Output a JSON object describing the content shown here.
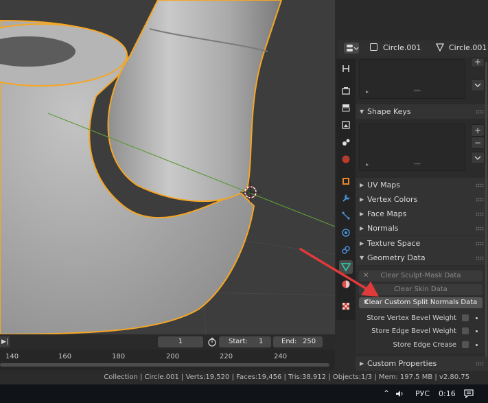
{
  "properties_header": {
    "object_name": "Circle.001",
    "mesh_name": "Circle.001"
  },
  "panels": {
    "shape_keys": "Shape Keys",
    "uv_maps": "UV Maps",
    "vertex_colors": "Vertex Colors",
    "face_maps": "Face Maps",
    "normals": "Normals",
    "texture_space": "Texture Space",
    "geometry_data": "Geometry Data",
    "custom_properties": "Custom Properties"
  },
  "geometry_data": {
    "clear_sculpt_mask": "Clear Sculpt-Mask Data",
    "clear_skin": "Clear Skin Data",
    "clear_custom_split_normals": "Clear Custom Split Normals Data",
    "store_vertex_bevel_weight": "Store Vertex Bevel Weight",
    "store_edge_bevel_weight": "Store Edge Bevel Weight",
    "store_edge_crease": "Store Edge Crease"
  },
  "timeline": {
    "current_frame": "1",
    "start_label": "Start:",
    "start_value": "1",
    "end_label": "End:",
    "end_value": "250",
    "ticks": [
      "140",
      "160",
      "180",
      "200",
      "220",
      "240"
    ]
  },
  "status_bar": {
    "text": "Collection | Circle.001 | Verts:19,520 | Faces:19,456 | Tris:38,912 | Objects:1/3 | Mem: 197.5 MB | v2.80.75"
  },
  "taskbar": {
    "language": "РУС",
    "time": "0:16"
  },
  "colors": {
    "selection_outline": "#f5a623",
    "annotation_arrow": "#e03a3a",
    "active_tab": "#4a4a4a"
  }
}
